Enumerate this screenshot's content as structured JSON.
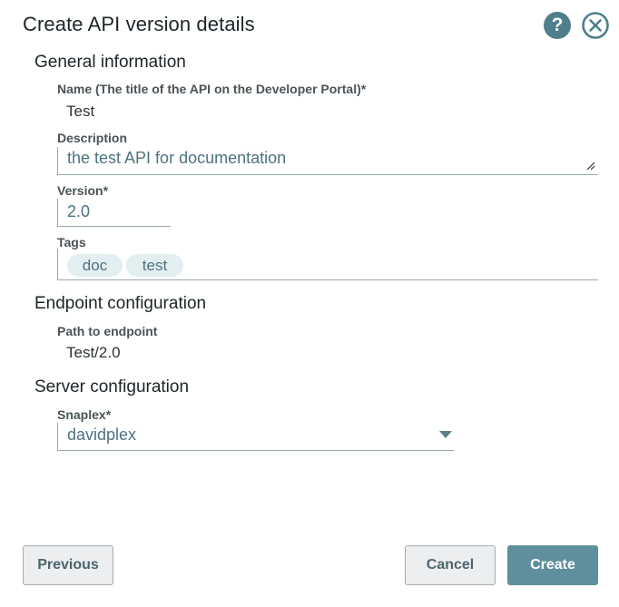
{
  "dialog": {
    "title": "Create API version details",
    "help_icon": "question-circle-icon",
    "help_glyph": "?",
    "close_icon": "close-circle-icon"
  },
  "general": {
    "title": "General information",
    "name_label": "Name (The title of the API on the Developer Portal)*",
    "name_value": "Test",
    "description_label": "Description",
    "description_value": "the test API for documentation",
    "version_label": "Version*",
    "version_value": "2.0",
    "tags_label": "Tags",
    "tags": [
      "doc",
      "test"
    ]
  },
  "endpoint": {
    "title": "Endpoint configuration",
    "path_label": "Path to endpoint",
    "path_value": "Test/2.0"
  },
  "server": {
    "title": "Server configuration",
    "snaplex_label": "Snaplex*",
    "snaplex_value": "davidplex"
  },
  "footer": {
    "previous_label": "Previous",
    "cancel_label": "Cancel",
    "create_label": "Create"
  },
  "colors": {
    "accent": "#5f8f9c",
    "help_icon_bg": "#4f7e8c",
    "tag_bg": "#e3eef1"
  }
}
